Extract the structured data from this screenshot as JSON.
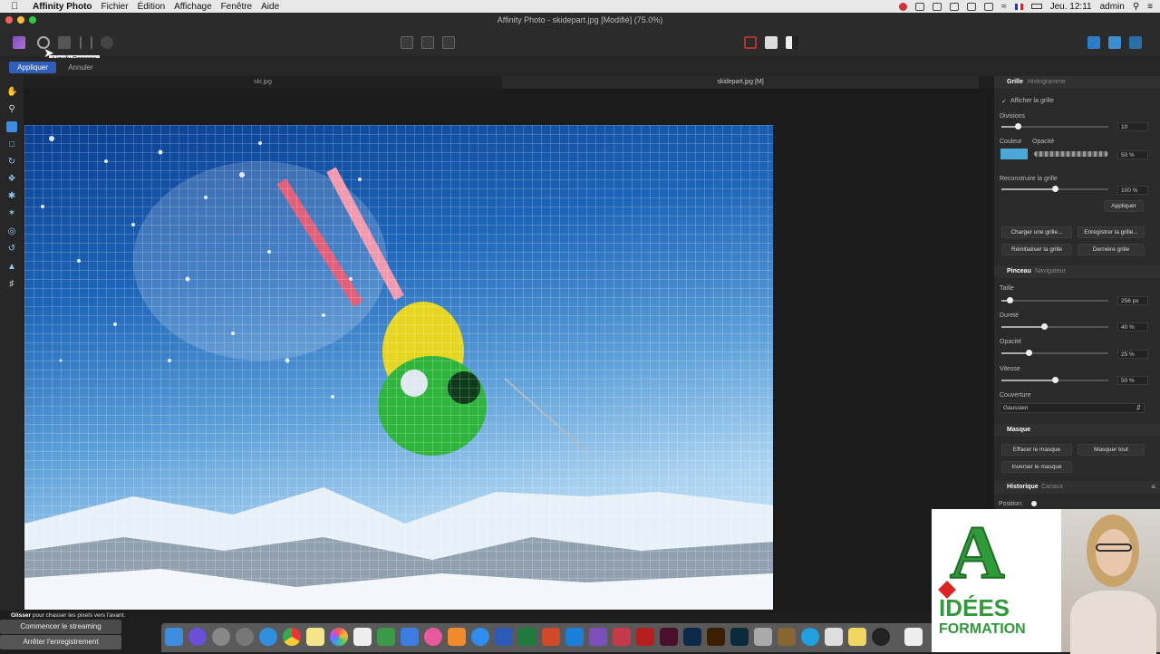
{
  "menubar": {
    "app_name": "Affinity Photo",
    "items": [
      "Fichier",
      "Édition",
      "Affichage",
      "Fenêtre",
      "Aide"
    ],
    "clock": "Jeu. 12:11",
    "user": "admin"
  },
  "window": {
    "title": "Affinity Photo - skidepart.jpg [Modifié] (75.0%)"
  },
  "toolbar": {
    "tooltip": "Liquify Persona"
  },
  "context": {
    "apply_label": "Appliquer",
    "cancel_label": "Annuler"
  },
  "tabs": [
    {
      "label": "ski.jpg",
      "active": false
    },
    {
      "label": "skidepart.jpg [M]",
      "active": true
    }
  ],
  "panel": {
    "grid_section": {
      "tabs": [
        "Grille",
        "Histogramme"
      ],
      "show_grid": "Afficher la grille",
      "divisions_label": "Divisions",
      "divisions_value": "10",
      "divisions_level": 0.15,
      "color_label": "Couleur",
      "opacity_label": "Opacité",
      "opacity_value": "50 %",
      "grid_color": "#4aa7d6",
      "rebuild_label": "Reconstruire la grille",
      "rebuild_value": "100 %",
      "rebuild_level": 0.5,
      "apply_button": "Appliquer",
      "load_button": "Charger une grille...",
      "save_button": "Enregistrer la grille...",
      "reset_button": "Réinitialiser la grille",
      "last_button": "Dernière grille"
    },
    "brush_section": {
      "tabs": [
        "Pinceau",
        "Navigateur"
      ],
      "size_label": "Taille",
      "size_value": "256 px",
      "size_level": 0.08,
      "hardness_label": "Dureté",
      "hardness_value": "40 %",
      "hardness_level": 0.4,
      "opacity_label": "Opacité",
      "opacity_value": "25 %",
      "opacity_level": 0.25,
      "speed_label": "Vitesse",
      "speed_value": "50 %",
      "speed_level": 0.5,
      "coverage_label": "Couverture",
      "coverage_value": "Gaussien"
    },
    "mask_section": {
      "title": "Masque",
      "clear_button": "Effacer le masque",
      "mask_all_button": "Masquer tout",
      "invert_button": "Inverser le masque"
    },
    "history_section": {
      "tabs": [
        "Historique",
        "Canaux"
      ],
      "position_label": "Position:"
    }
  },
  "hint": {
    "bold": "Glisser",
    "text": " pour chasser les pixels vers l'avant."
  },
  "stream": {
    "start": "Commencer le streaming",
    "stop": "Arrêter l'enregistrement"
  },
  "logo": {
    "letter": "A",
    "line1": "IDÉES",
    "line2": "FORMATION"
  }
}
